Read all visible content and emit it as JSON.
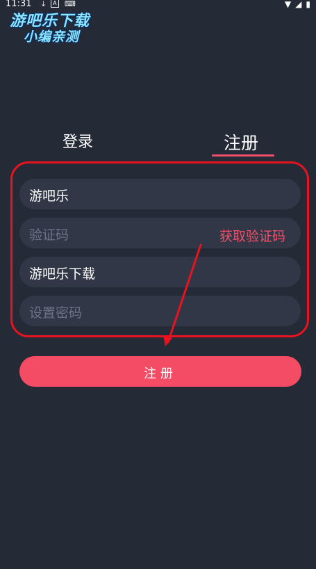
{
  "status_bar": {
    "time": "11:31",
    "icons_left": [
      "download-icon",
      "a-box-icon",
      "keyboard-icon"
    ],
    "icons_right": [
      "wifi-icon",
      "signal-icon",
      "battery-icon"
    ]
  },
  "watermark": {
    "line1": "游吧乐下载",
    "line2": "小编亲测"
  },
  "tabs": {
    "login": "登录",
    "register": "注册"
  },
  "form": {
    "username": "游吧乐",
    "code_placeholder": "验证码",
    "get_code": "获取验证码",
    "name": "游吧乐下载",
    "password_placeholder": "设置密码"
  },
  "submit": "注册",
  "colors": {
    "background": "#252a37",
    "field": "#313746",
    "accent": "#f1506a",
    "annotation": "#e8131e"
  }
}
